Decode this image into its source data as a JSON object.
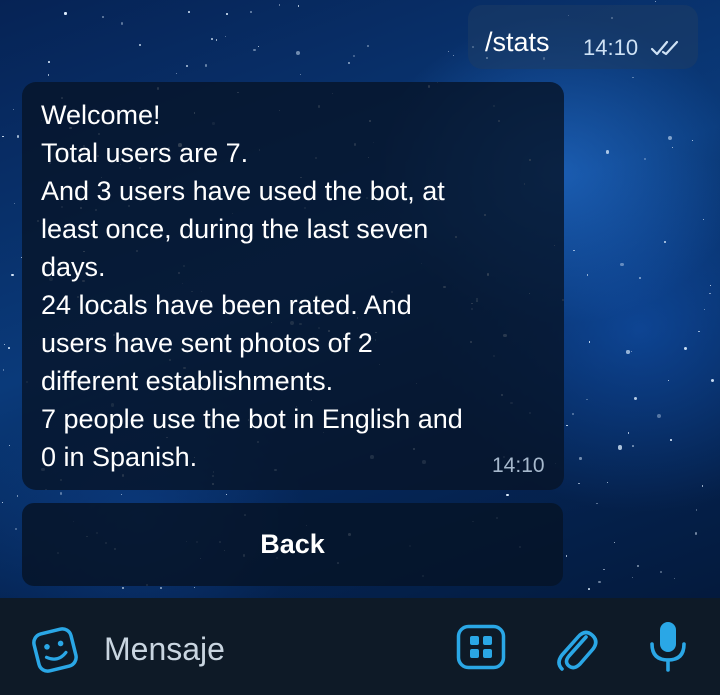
{
  "outgoing": {
    "text": "/stats",
    "time": "14:10"
  },
  "incoming": {
    "lines": [
      "Welcome!",
      "Total users are 7.",
      "And 3 users have used the bot, at",
      "least once, during the last seven",
      "days.",
      "24 locals have been rated. And",
      "users have sent photos of 2",
      "different establishments.",
      "7 people use the bot in English and",
      "0 in Spanish."
    ],
    "time": "14:10"
  },
  "keyboard": {
    "back_label": "Back"
  },
  "composer": {
    "placeholder": "Mensaje"
  },
  "icons": {
    "emoji": "sticker-emoji-icon",
    "bot_commands": "bot-keyboard-icon",
    "attach": "paperclip-icon",
    "mic": "microphone-icon",
    "read_status": "double-check-icon"
  },
  "colors": {
    "accent": "#2aa7e6",
    "bubble_dark": "#06142a",
    "bar": "#0e1a27"
  }
}
